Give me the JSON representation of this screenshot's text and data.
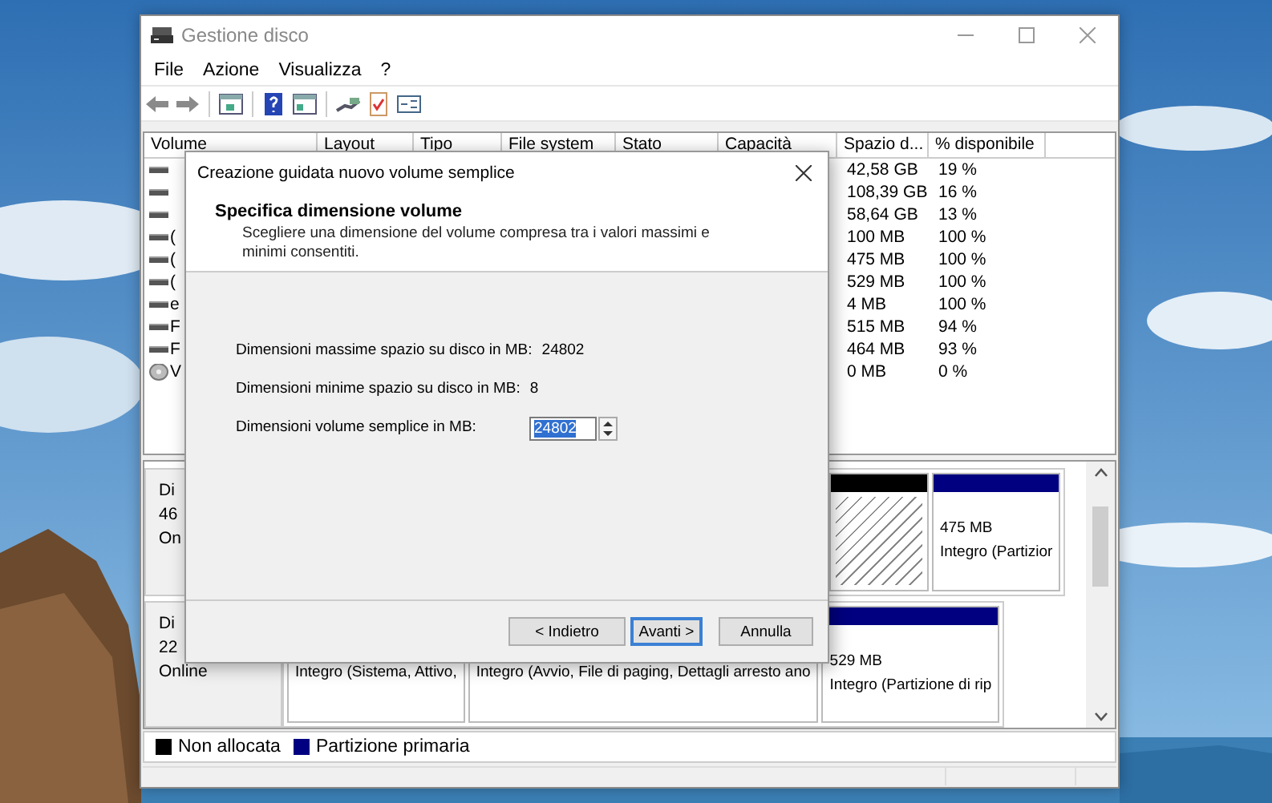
{
  "window": {
    "title": "Gestione disco"
  },
  "menu": [
    "File",
    "Azione",
    "Visualizza",
    "?"
  ],
  "volume_list": {
    "columns": [
      "Volume",
      "Layout",
      "Tipo",
      "File system",
      "Stato",
      "Capacità",
      "Spazio d...",
      "% disponibile"
    ],
    "rows": [
      {
        "kind": "disk",
        "free": "42,58 GB",
        "percent": "19 %"
      },
      {
        "kind": "disk",
        "free": "108,39 GB",
        "percent": "16 %"
      },
      {
        "kind": "disk",
        "free": "58,64 GB",
        "percent": "13 %"
      },
      {
        "kind": "disk",
        "volume": "(",
        "free": "100 MB",
        "percent": "100 %"
      },
      {
        "kind": "disk",
        "volume": "(",
        "free": "475 MB",
        "percent": "100 %"
      },
      {
        "kind": "disk",
        "volume": "(",
        "free": "529 MB",
        "percent": "100 %"
      },
      {
        "kind": "disk",
        "volume": "e",
        "free": "4 MB",
        "percent": "100 %"
      },
      {
        "kind": "disk",
        "volume": "F",
        "free": "515 MB",
        "percent": "94 %"
      },
      {
        "kind": "disk",
        "volume": "F",
        "free": "464 MB",
        "percent": "93 %"
      },
      {
        "kind": "optical",
        "volume": "V",
        "free": "0 MB",
        "percent": "0 %"
      }
    ]
  },
  "disks": [
    {
      "label": [
        "Di",
        "46",
        "On"
      ],
      "partitions": [
        {
          "kind": "unallocated"
        },
        {
          "kind": "primary",
          "size": "475 MB",
          "status": "Integro (Partizior"
        }
      ]
    },
    {
      "label": [
        "Di",
        "22",
        "Online"
      ],
      "partitions": [
        {
          "kind": "primary",
          "status": "Integro (Sistema, Attivo,"
        },
        {
          "kind": "primary",
          "status": "Integro (Avvio, File di paging, Dettagli arresto ano"
        },
        {
          "kind": "primary",
          "size": "529 MB",
          "status": "Integro (Partizione di rip"
        }
      ]
    }
  ],
  "legend": [
    {
      "label": "Non allocata",
      "color": "#000000"
    },
    {
      "label": "Partizione primaria",
      "color": "#000080"
    }
  ],
  "dialog": {
    "title": "Creazione guidata nuovo volume semplice",
    "heading": "Specifica dimensione volume",
    "description": "Scegliere una dimensione del volume compresa tra i valori massimi e minimi consentiti.",
    "fields": [
      {
        "label": "Dimensioni massime spazio su disco in MB:",
        "value": "24802"
      },
      {
        "label": "Dimensioni minime spazio su disco in MB:",
        "value": "8"
      }
    ],
    "size_field": {
      "label": "Dimensioni volume semplice in MB:",
      "value": "24802",
      "value_selected": true
    },
    "buttons": [
      {
        "label": "< Indietro",
        "focused": false
      },
      {
        "label": "Avanti >",
        "focused": true
      },
      {
        "label": "Annulla",
        "focused": false
      }
    ]
  }
}
